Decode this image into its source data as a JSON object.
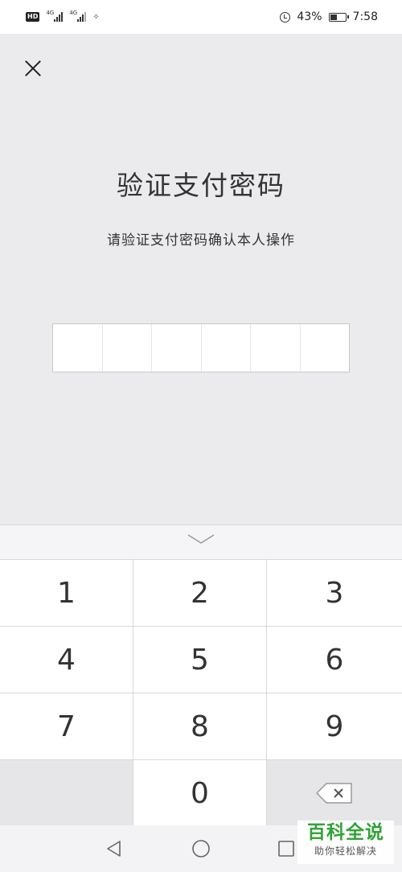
{
  "status_bar": {
    "left_icons": [
      "hd-icon",
      "signal-4g-icon",
      "signal-4g-icon",
      "misc-icon"
    ],
    "hd_label": "HD",
    "sim1_tag": "4G",
    "sim2_tag": "4G",
    "battery_percent": "43%",
    "time": "7:58"
  },
  "header": {
    "close_icon": "close-icon"
  },
  "main": {
    "title": "验证支付密码",
    "subtitle": "请验证支付密码确认本人操作",
    "pin_length": 6
  },
  "keypad": {
    "collapse_icon": "chevron-down-icon",
    "keys": [
      "1",
      "2",
      "3",
      "4",
      "5",
      "6",
      "7",
      "8",
      "9",
      "",
      "0",
      "backspace-icon"
    ]
  },
  "nav_bar": {
    "buttons": [
      "back-triangle-icon",
      "home-circle-icon",
      "recent-square-icon"
    ]
  },
  "watermark": {
    "main": "百科全说",
    "sub": "助你轻松解决",
    "color": "#31a336"
  },
  "colors": {
    "background": "#ebeaed",
    "keypad_key": "#ffffff",
    "keypad_function": "#e6e6e8",
    "text": "#333333"
  }
}
